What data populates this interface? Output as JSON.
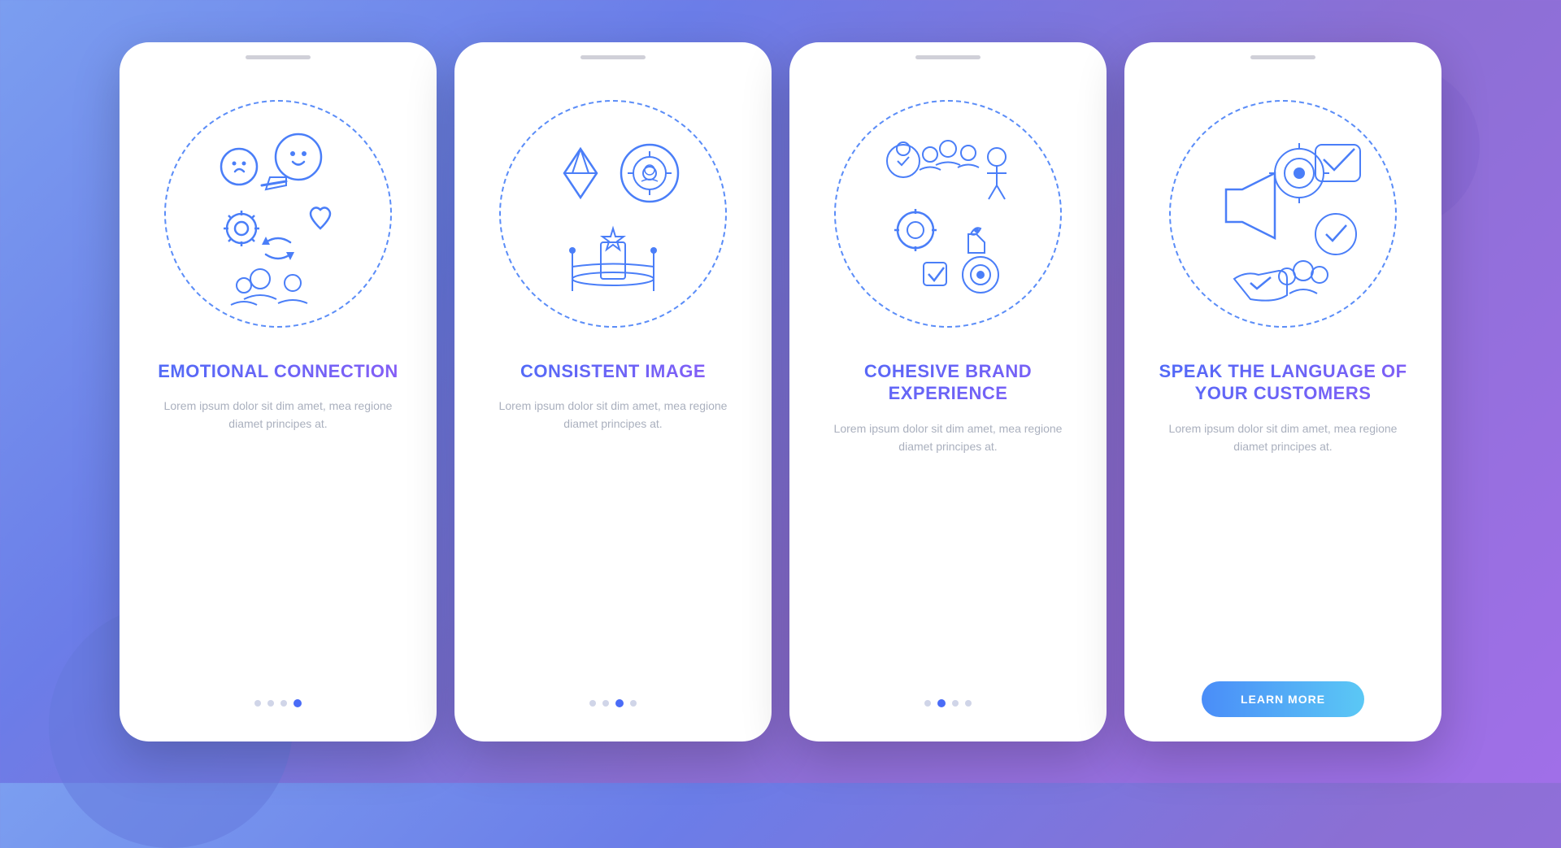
{
  "background": {
    "gradient_start": "#7b9ef0",
    "gradient_end": "#a06fe8"
  },
  "cards": [
    {
      "id": "card-1",
      "title": "EMOTIONAL CONNECTION",
      "body_text": "Lorem ipsum dolor sit dim amet, mea regione diamet principes at.",
      "dots": [
        {
          "active": false
        },
        {
          "active": false
        },
        {
          "active": false
        },
        {
          "active": true
        }
      ],
      "has_button": false
    },
    {
      "id": "card-2",
      "title": "CONSISTENT IMAGE",
      "body_text": "Lorem ipsum dolor sit dim amet, mea regione diamet principes at.",
      "dots": [
        {
          "active": false
        },
        {
          "active": false
        },
        {
          "active": true
        },
        {
          "active": false
        }
      ],
      "has_button": false
    },
    {
      "id": "card-3",
      "title": "COHESIVE BRAND EXPERIENCE",
      "body_text": "Lorem ipsum dolor sit dim amet, mea regione diamet principes at.",
      "dots": [
        {
          "active": false
        },
        {
          "active": true
        },
        {
          "active": false
        },
        {
          "active": false
        }
      ],
      "has_button": false
    },
    {
      "id": "card-4",
      "title": "SPEAK THE LANGUAGE OF YOUR CUSTOMERS",
      "body_text": "Lorem ipsum dolor sit dim amet, mea regione diamet principes at.",
      "dots": [],
      "has_button": true,
      "button_label": "LEARN MORE"
    }
  ]
}
